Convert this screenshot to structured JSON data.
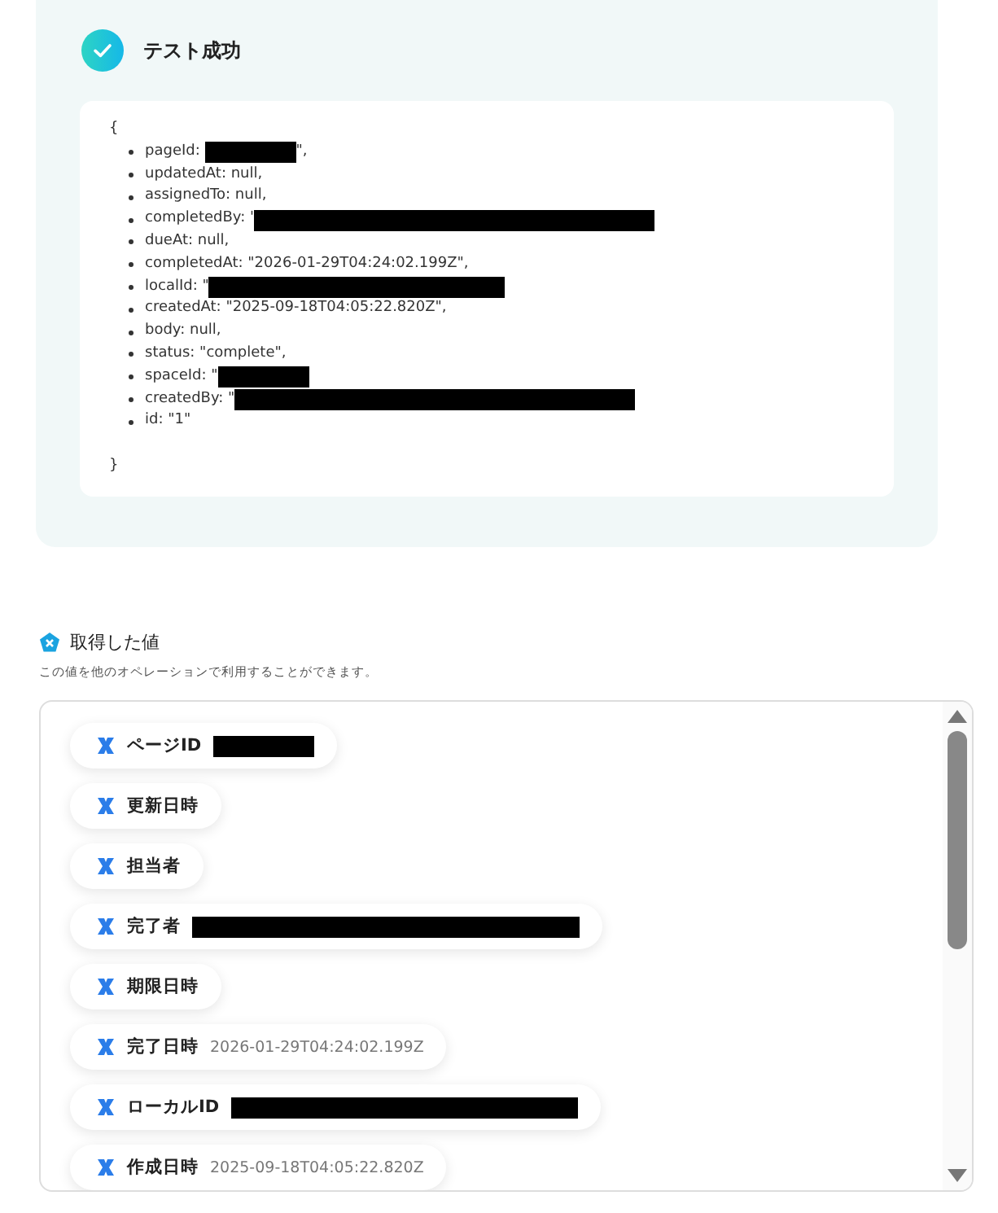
{
  "result": {
    "title": "テスト成功",
    "open_brace": "{",
    "close_brace": "}",
    "lines": [
      {
        "text": "pageId: ",
        "redacted": true,
        "after": "\","
      },
      {
        "text": "updatedAt: null,"
      },
      {
        "text": "assignedTo: null,"
      },
      {
        "text": "completedBy: '",
        "redacted": true
      },
      {
        "text": "dueAt: null,"
      },
      {
        "text": "completedAt: \"2026-01-29T04:24:02.199Z\","
      },
      {
        "text": "localId: \"",
        "redacted": true
      },
      {
        "text": "createdAt: \"2025-09-18T04:05:22.820Z\","
      },
      {
        "text": "body: null,"
      },
      {
        "text": "status: \"complete\","
      },
      {
        "text": "spaceId: \"",
        "redacted": true
      },
      {
        "text": "createdBy: \"",
        "redacted": true
      },
      {
        "text": "id: \"1\""
      }
    ]
  },
  "values": {
    "title": "取得した値",
    "description": "この値を他のオペレーションで利用することができます。",
    "items": [
      {
        "label": "ページID",
        "redacted": true
      },
      {
        "label": "更新日時"
      },
      {
        "label": "担当者"
      },
      {
        "label": "完了者",
        "redacted": true
      },
      {
        "label": "期限日時"
      },
      {
        "label": "完了日時",
        "value": "2026-01-29T04:24:02.199Z"
      },
      {
        "label": "ローカルID",
        "redacted": true
      },
      {
        "label": "作成日時",
        "value": "2025-09-18T04:05:22.820Z"
      }
    ]
  }
}
